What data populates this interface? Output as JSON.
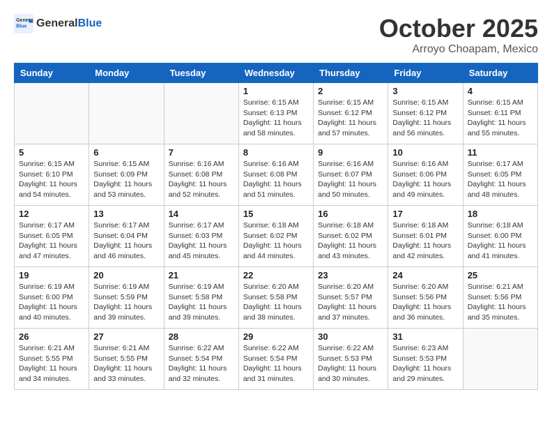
{
  "header": {
    "logo_general": "General",
    "logo_blue": "Blue",
    "month": "October 2025",
    "location": "Arroyo Choapam, Mexico"
  },
  "weekdays": [
    "Sunday",
    "Monday",
    "Tuesday",
    "Wednesday",
    "Thursday",
    "Friday",
    "Saturday"
  ],
  "weeks": [
    [
      {
        "day": "",
        "info": ""
      },
      {
        "day": "",
        "info": ""
      },
      {
        "day": "",
        "info": ""
      },
      {
        "day": "1",
        "info": "Sunrise: 6:15 AM\nSunset: 6:13 PM\nDaylight: 11 hours\nand 58 minutes."
      },
      {
        "day": "2",
        "info": "Sunrise: 6:15 AM\nSunset: 6:12 PM\nDaylight: 11 hours\nand 57 minutes."
      },
      {
        "day": "3",
        "info": "Sunrise: 6:15 AM\nSunset: 6:12 PM\nDaylight: 11 hours\nand 56 minutes."
      },
      {
        "day": "4",
        "info": "Sunrise: 6:15 AM\nSunset: 6:11 PM\nDaylight: 11 hours\nand 55 minutes."
      }
    ],
    [
      {
        "day": "5",
        "info": "Sunrise: 6:15 AM\nSunset: 6:10 PM\nDaylight: 11 hours\nand 54 minutes."
      },
      {
        "day": "6",
        "info": "Sunrise: 6:15 AM\nSunset: 6:09 PM\nDaylight: 11 hours\nand 53 minutes."
      },
      {
        "day": "7",
        "info": "Sunrise: 6:16 AM\nSunset: 6:08 PM\nDaylight: 11 hours\nand 52 minutes."
      },
      {
        "day": "8",
        "info": "Sunrise: 6:16 AM\nSunset: 6:08 PM\nDaylight: 11 hours\nand 51 minutes."
      },
      {
        "day": "9",
        "info": "Sunrise: 6:16 AM\nSunset: 6:07 PM\nDaylight: 11 hours\nand 50 minutes."
      },
      {
        "day": "10",
        "info": "Sunrise: 6:16 AM\nSunset: 6:06 PM\nDaylight: 11 hours\nand 49 minutes."
      },
      {
        "day": "11",
        "info": "Sunrise: 6:17 AM\nSunset: 6:05 PM\nDaylight: 11 hours\nand 48 minutes."
      }
    ],
    [
      {
        "day": "12",
        "info": "Sunrise: 6:17 AM\nSunset: 6:05 PM\nDaylight: 11 hours\nand 47 minutes."
      },
      {
        "day": "13",
        "info": "Sunrise: 6:17 AM\nSunset: 6:04 PM\nDaylight: 11 hours\nand 46 minutes."
      },
      {
        "day": "14",
        "info": "Sunrise: 6:17 AM\nSunset: 6:03 PM\nDaylight: 11 hours\nand 45 minutes."
      },
      {
        "day": "15",
        "info": "Sunrise: 6:18 AM\nSunset: 6:02 PM\nDaylight: 11 hours\nand 44 minutes."
      },
      {
        "day": "16",
        "info": "Sunrise: 6:18 AM\nSunset: 6:02 PM\nDaylight: 11 hours\nand 43 minutes."
      },
      {
        "day": "17",
        "info": "Sunrise: 6:18 AM\nSunset: 6:01 PM\nDaylight: 11 hours\nand 42 minutes."
      },
      {
        "day": "18",
        "info": "Sunrise: 6:18 AM\nSunset: 6:00 PM\nDaylight: 11 hours\nand 41 minutes."
      }
    ],
    [
      {
        "day": "19",
        "info": "Sunrise: 6:19 AM\nSunset: 6:00 PM\nDaylight: 11 hours\nand 40 minutes."
      },
      {
        "day": "20",
        "info": "Sunrise: 6:19 AM\nSunset: 5:59 PM\nDaylight: 11 hours\nand 39 minutes."
      },
      {
        "day": "21",
        "info": "Sunrise: 6:19 AM\nSunset: 5:58 PM\nDaylight: 11 hours\nand 39 minutes."
      },
      {
        "day": "22",
        "info": "Sunrise: 6:20 AM\nSunset: 5:58 PM\nDaylight: 11 hours\nand 38 minutes."
      },
      {
        "day": "23",
        "info": "Sunrise: 6:20 AM\nSunset: 5:57 PM\nDaylight: 11 hours\nand 37 minutes."
      },
      {
        "day": "24",
        "info": "Sunrise: 6:20 AM\nSunset: 5:56 PM\nDaylight: 11 hours\nand 36 minutes."
      },
      {
        "day": "25",
        "info": "Sunrise: 6:21 AM\nSunset: 5:56 PM\nDaylight: 11 hours\nand 35 minutes."
      }
    ],
    [
      {
        "day": "26",
        "info": "Sunrise: 6:21 AM\nSunset: 5:55 PM\nDaylight: 11 hours\nand 34 minutes."
      },
      {
        "day": "27",
        "info": "Sunrise: 6:21 AM\nSunset: 5:55 PM\nDaylight: 11 hours\nand 33 minutes."
      },
      {
        "day": "28",
        "info": "Sunrise: 6:22 AM\nSunset: 5:54 PM\nDaylight: 11 hours\nand 32 minutes."
      },
      {
        "day": "29",
        "info": "Sunrise: 6:22 AM\nSunset: 5:54 PM\nDaylight: 11 hours\nand 31 minutes."
      },
      {
        "day": "30",
        "info": "Sunrise: 6:22 AM\nSunset: 5:53 PM\nDaylight: 11 hours\nand 30 minutes."
      },
      {
        "day": "31",
        "info": "Sunrise: 6:23 AM\nSunset: 5:53 PM\nDaylight: 11 hours\nand 29 minutes."
      },
      {
        "day": "",
        "info": ""
      }
    ]
  ]
}
